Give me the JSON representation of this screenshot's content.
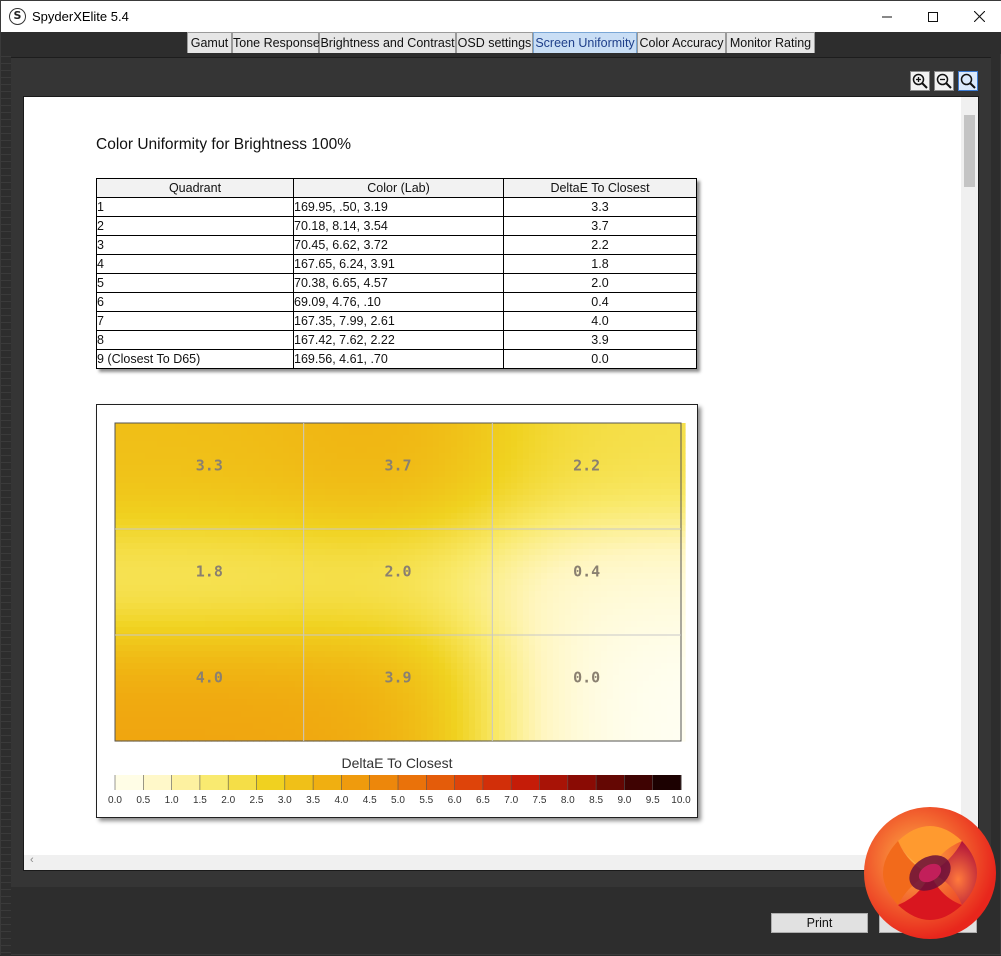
{
  "window": {
    "title": "SpyderXElite 5.4",
    "app_icon_glyph": "S"
  },
  "tabs": [
    {
      "label": "Gamut",
      "active": false
    },
    {
      "label": "Tone Response",
      "active": false
    },
    {
      "label": "Brightness and Contrast",
      "active": false
    },
    {
      "label": "OSD settings",
      "active": false
    },
    {
      "label": "Screen Uniformity",
      "active": true
    },
    {
      "label": "Color Accuracy",
      "active": false
    },
    {
      "label": "Monitor Rating",
      "active": false
    }
  ],
  "zoom": {
    "zoom_in_icon": "zoom-in-icon",
    "zoom_out_icon": "zoom-out-icon",
    "zoom_fit_icon": "zoom-fit-icon"
  },
  "report": {
    "title": "Color Uniformity for Brightness 100%",
    "table": {
      "headers": [
        "Quadrant",
        "Color (Lab)",
        "DeltaE To Closest"
      ],
      "rows": [
        {
          "quadrant": "1",
          "lab": "169.95,    .50,   3.19",
          "delta": "3.3"
        },
        {
          "quadrant": "2",
          "lab": "70.18,   8.14,   3.54",
          "delta": "3.7"
        },
        {
          "quadrant": "3",
          "lab": "70.45,   6.62,   3.72",
          "delta": "2.2"
        },
        {
          "quadrant": "4",
          "lab": "167.65,   6.24,   3.91",
          "delta": "1.8"
        },
        {
          "quadrant": "5",
          "lab": "70.38,   6.65,   4.57",
          "delta": "2.0"
        },
        {
          "quadrant": "6",
          "lab": "69.09,   4.76,    .10",
          "delta": "0.4"
        },
        {
          "quadrant": "7",
          "lab": "167.35,   7.99,   2.61",
          "delta": "4.0"
        },
        {
          "quadrant": "8",
          "lab": "167.42,   7.62,   2.22",
          "delta": "3.9"
        },
        {
          "quadrant": "9 (Closest To D65)",
          "lab": "169.56,   4.61,    .70",
          "delta": "0.0"
        }
      ]
    }
  },
  "chart_data": {
    "type": "heatmap",
    "title": "",
    "legend_title": "DeltaE To Closest",
    "grid": {
      "rows": 3,
      "cols": 3
    },
    "values": [
      [
        3.3,
        3.7,
        2.2
      ],
      [
        1.8,
        2.0,
        0.4
      ],
      [
        4.0,
        3.9,
        0.0
      ]
    ],
    "value_labels": [
      [
        "3.3",
        "3.7",
        "2.2"
      ],
      [
        "1.8",
        "2.0",
        "0.4"
      ],
      [
        "4.0",
        "3.9",
        "0.0"
      ]
    ],
    "colorbar": {
      "min": 0.0,
      "max": 10.0,
      "ticks": [
        "0.0",
        "0.5",
        "1.0",
        "1.5",
        "2.0",
        "2.5",
        "3.0",
        "3.5",
        "4.0",
        "4.5",
        "5.0",
        "5.5",
        "6.0",
        "6.5",
        "7.0",
        "7.5",
        "8.0",
        "8.5",
        "9.0",
        "9.5",
        "10.0"
      ]
    },
    "colors": [
      "#fffff4",
      "#fff6c0",
      "#f9e96a",
      "#f0d220",
      "#f0b312",
      "#ef8f0b",
      "#e86a0a",
      "#dc3e0a",
      "#c41b08",
      "#8f0c04",
      "#4a0402",
      "#0a0000"
    ],
    "grid_lines": true
  },
  "footer": {
    "print_label": "Print"
  }
}
